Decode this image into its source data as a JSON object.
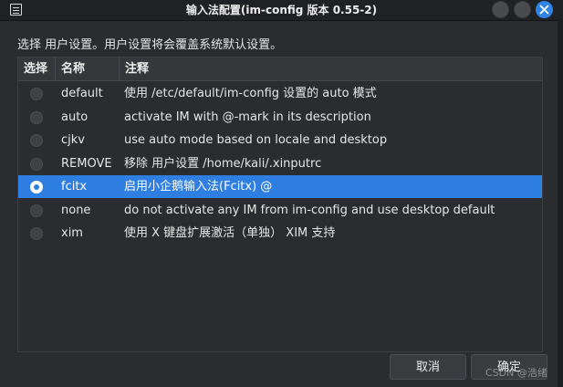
{
  "window": {
    "title": "输入法配置(im-config 版本 0.55-2)"
  },
  "instruction": "选择 用户设置。用户设置将会覆盖系统默认设置。",
  "table": {
    "columns": [
      "选择",
      "名称",
      "注释"
    ],
    "rows": [
      {
        "name": "default",
        "description": "使用 /etc/default/im-config 设置的 auto 模式",
        "selected": false
      },
      {
        "name": "auto",
        "description": "activate IM with @-mark in its description",
        "selected": false
      },
      {
        "name": "cjkv",
        "description": "use auto mode based on locale and desktop",
        "selected": false
      },
      {
        "name": "REMOVE",
        "description": "移除 用户设置 /home/kali/.xinputrc",
        "selected": false
      },
      {
        "name": "fcitx",
        "description": "启用小企鹅输入法(Fcitx) @",
        "selected": true
      },
      {
        "name": "none",
        "description": "do not activate any IM from im-config and use desktop default",
        "selected": false
      },
      {
        "name": "xim",
        "description": "使用 X 键盘扩展激活（单独） XIM 支持",
        "selected": false
      }
    ]
  },
  "buttons": {
    "cancel": "取消",
    "ok": "确定"
  },
  "watermark": "CSDN @浩绪",
  "colors": {
    "selection": "#2f7fe2",
    "close_button": "#2e83e6",
    "background": "#2b2c2f"
  }
}
